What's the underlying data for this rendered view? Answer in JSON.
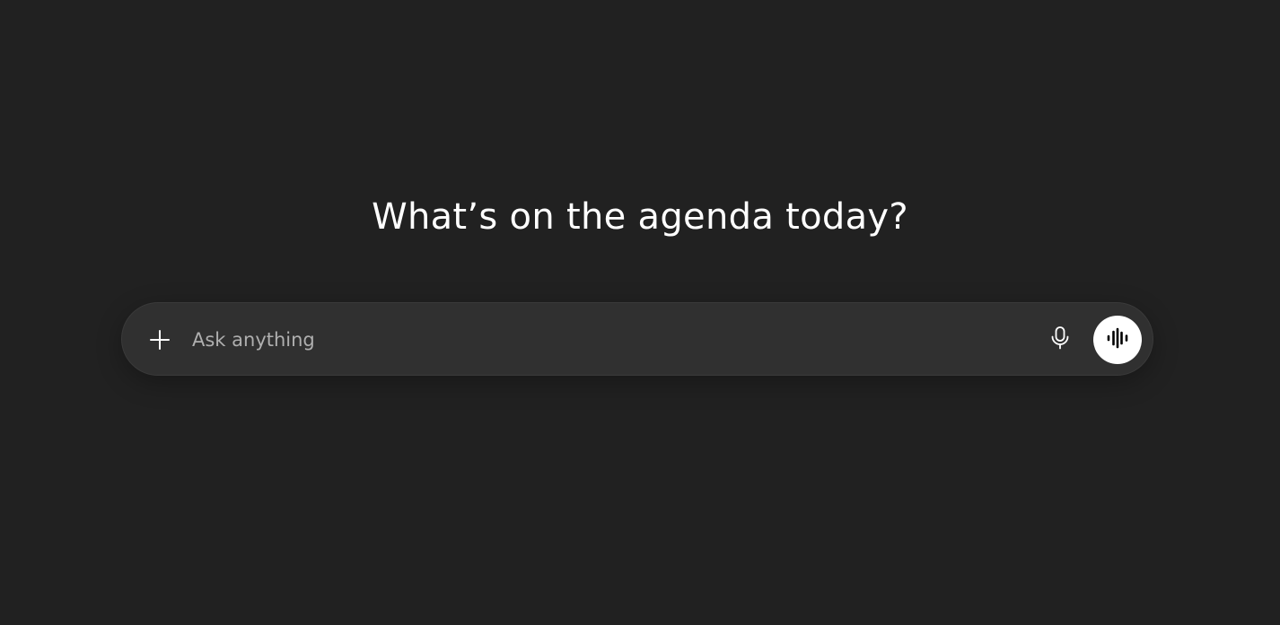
{
  "main": {
    "headline": "What’s on the agenda today?"
  },
  "composer": {
    "placeholder": "Ask anything",
    "value": "",
    "add_icon": "plus-icon",
    "dictate_icon": "microphone-icon",
    "voice_icon": "voice-waveform-icon"
  },
  "colors": {
    "background": "#212121",
    "composer_background": "#303030",
    "text": "#ffffff",
    "placeholder": "#afafaf",
    "voice_button": "#ffffff"
  }
}
